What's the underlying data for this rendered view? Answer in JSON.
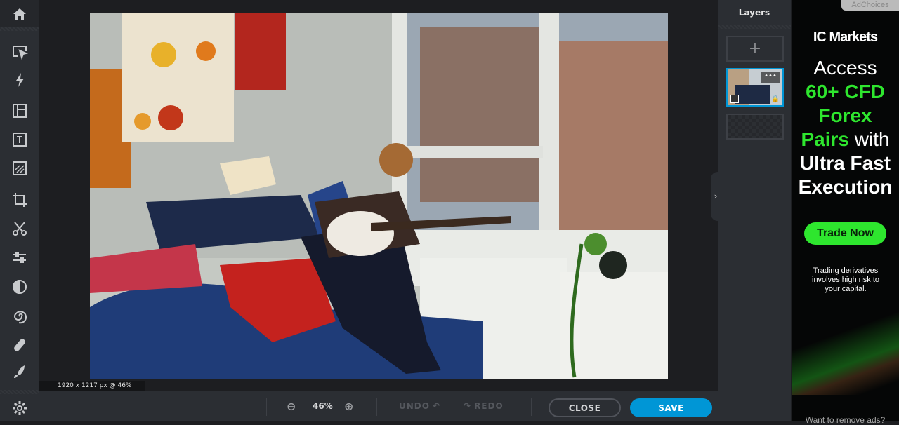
{
  "toolbar": {
    "items": [
      {
        "name": "home-icon"
      },
      {
        "name": "arrange-icon"
      },
      {
        "name": "quick-fix-icon"
      },
      {
        "name": "layout-icon"
      },
      {
        "name": "text-icon"
      },
      {
        "name": "element-icon"
      },
      {
        "name": "crop-icon"
      },
      {
        "name": "cutout-icon"
      },
      {
        "name": "adjust-icon"
      },
      {
        "name": "filter-icon"
      },
      {
        "name": "liquify-icon"
      },
      {
        "name": "heal-icon"
      },
      {
        "name": "brush-icon"
      },
      {
        "name": "settings-icon"
      }
    ]
  },
  "canvas": {
    "info": "1920 x 1217 px @ 46%"
  },
  "bottom": {
    "zoom": "46%",
    "undo": "UNDO",
    "redo": "REDO",
    "close": "CLOSE",
    "save": "SAVE"
  },
  "layers": {
    "title": "Layers",
    "add": "+"
  },
  "ad": {
    "adchoices": "AdChoices",
    "brand": "IC Markets",
    "line1": "Access",
    "line2": "60+ CFD",
    "line3": "Forex",
    "line4a": "Pairs",
    "line4b": " with",
    "line5": "Ultra Fast",
    "line6": "Execution",
    "cta": "Trade Now",
    "disclaimer": "Trading derivatives involves high risk to your capital.",
    "remove": "Want to remove ads?",
    "accent": "#2ee62e"
  },
  "colors": {
    "accent": "#0096d6"
  }
}
